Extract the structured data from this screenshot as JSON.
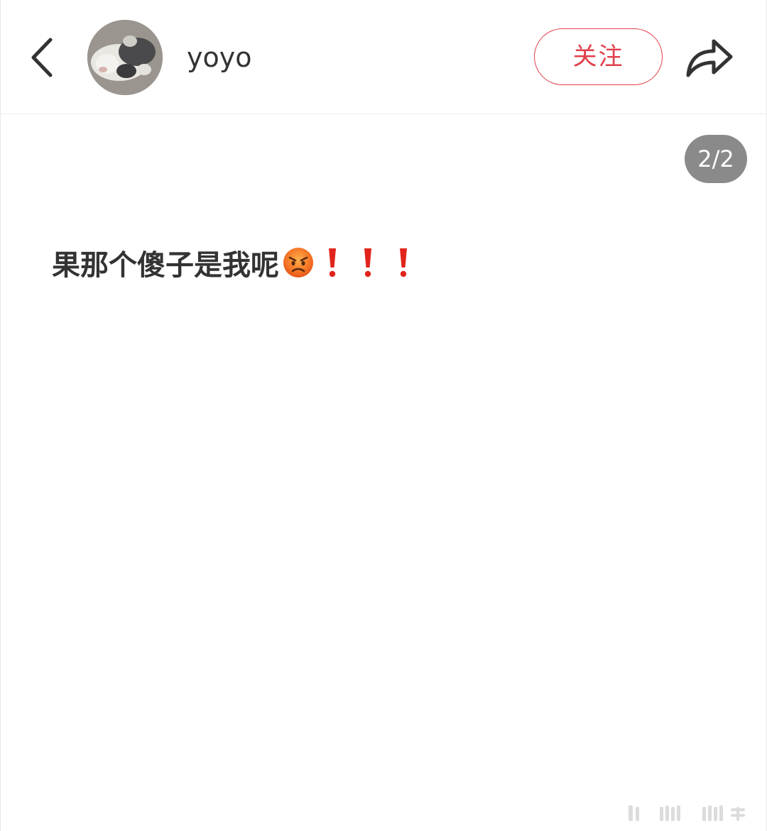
{
  "header": {
    "username": "yoyo",
    "follow_label": "关注",
    "icons": {
      "back": "chevron-left-icon",
      "share": "share-arrow-icon"
    }
  },
  "page_indicator": "2/2",
  "post": {
    "text": "果那个傻子是我呢",
    "emoji": [
      "angry-face-emoji",
      "red-exclamation-emoji",
      "red-exclamation-emoji",
      "red-exclamation-emoji"
    ]
  },
  "colors": {
    "accent": "#e0404b",
    "text_primary": "#333333",
    "indicator_bg": "#8a8a8a",
    "divider": "#ececec"
  }
}
